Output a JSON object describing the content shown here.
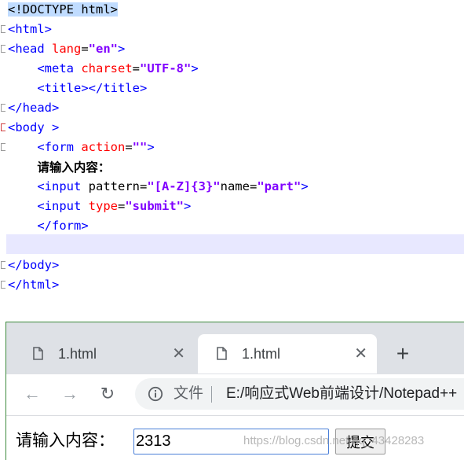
{
  "editor": {
    "lines": [
      {
        "parts": [
          {
            "k": "p",
            "t": "<!DOCTYPE html>",
            "sel": true
          }
        ]
      },
      {
        "parts": [
          {
            "k": "t",
            "t": "<html>"
          }
        ]
      },
      {
        "parts": [
          {
            "k": "t",
            "t": "<head "
          },
          {
            "k": "a",
            "t": "lang"
          },
          {
            "k": "p",
            "t": "="
          },
          {
            "k": "v",
            "t": "\"en\""
          },
          {
            "k": "t",
            "t": ">"
          }
        ]
      },
      {
        "parts": [
          {
            "k": "p",
            "t": "    "
          },
          {
            "k": "t",
            "t": "<meta "
          },
          {
            "k": "a",
            "t": "charset"
          },
          {
            "k": "p",
            "t": "="
          },
          {
            "k": "v",
            "t": "\"UTF-8\""
          },
          {
            "k": "t",
            "t": ">"
          }
        ]
      },
      {
        "parts": [
          {
            "k": "p",
            "t": "    "
          },
          {
            "k": "t",
            "t": "<title></title>"
          }
        ]
      },
      {
        "parts": [
          {
            "k": "t",
            "t": "</head>"
          }
        ]
      },
      {
        "parts": [
          {
            "k": "t",
            "t": "<body >"
          }
        ]
      },
      {
        "parts": [
          {
            "k": "p",
            "t": "    "
          },
          {
            "k": "t",
            "t": "<form "
          },
          {
            "k": "a",
            "t": "action"
          },
          {
            "k": "p",
            "t": "="
          },
          {
            "k": "v",
            "t": "\"\""
          },
          {
            "k": "t",
            "t": ">"
          }
        ]
      },
      {
        "parts": [
          {
            "k": "p",
            "t": "    "
          },
          {
            "k": "zh",
            "t": "请输入内容："
          }
        ]
      },
      {
        "parts": [
          {
            "k": "p",
            "t": "    "
          },
          {
            "k": "t",
            "t": "<input "
          },
          {
            "k": "p",
            "t": "pattern="
          },
          {
            "k": "v",
            "t": "\"[A-Z]{3}\""
          },
          {
            "k": "p",
            "t": "name="
          },
          {
            "k": "v",
            "t": "\"part\""
          },
          {
            "k": "t",
            "t": ">"
          }
        ]
      },
      {
        "parts": [
          {
            "k": "p",
            "t": "    "
          },
          {
            "k": "t",
            "t": "<input "
          },
          {
            "k": "a",
            "t": "type"
          },
          {
            "k": "p",
            "t": "="
          },
          {
            "k": "v",
            "t": "\"submit\""
          },
          {
            "k": "t",
            "t": ">"
          }
        ]
      },
      {
        "parts": [
          {
            "k": "p",
            "t": "    "
          },
          {
            "k": "t",
            "t": "</form>"
          }
        ]
      },
      {
        "parts": [
          {
            "k": "p",
            "t": ""
          }
        ]
      },
      {
        "parts": [
          {
            "k": "t",
            "t": "</body>"
          }
        ]
      },
      {
        "parts": [
          {
            "k": "t",
            "t": "</html>"
          }
        ]
      }
    ],
    "colors": {
      "tag": "#0000ff",
      "attr": "#ff0000",
      "value": "#8000ff",
      "current_line": "#e8e8ff",
      "selection": "#c0dcff"
    }
  },
  "browser": {
    "tabs": [
      {
        "title": "1.html",
        "close": "✕",
        "active": false
      },
      {
        "title": "1.html",
        "close": "✕",
        "active": true
      }
    ],
    "new_tab": "+",
    "back": "←",
    "forward": "→",
    "reload": "↻",
    "chip": "文件",
    "url": "E:/响应式Web前端设计/Notepad++",
    "page": {
      "label": "请输入内容：",
      "input_value": "2313",
      "submit_label": "提交"
    },
    "watermark": "https://blog.csdn.net/qq_43428283"
  }
}
